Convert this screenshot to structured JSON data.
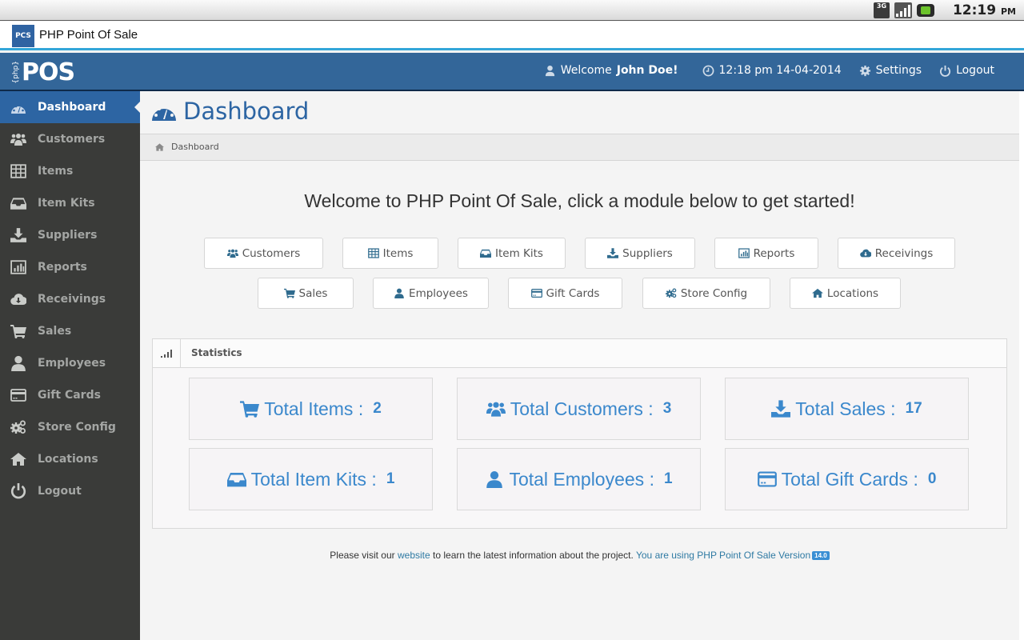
{
  "statusbar": {
    "network": "3G",
    "time": "12:19",
    "ampm": "PM"
  },
  "app": {
    "title": "PHP Point Of Sale",
    "logo_text": "PCS"
  },
  "header": {
    "logo_prefix": "{php}",
    "logo_text": "POS",
    "welcome_prefix": "Welcome",
    "user_name": "John Doe!",
    "datetime": "12:18 pm 14-04-2014",
    "settings_label": "Settings",
    "logout_label": "Logout"
  },
  "sidebar": {
    "items": [
      {
        "label": "Dashboard",
        "icon": "dashboard-icon",
        "active": true
      },
      {
        "label": "Customers",
        "icon": "users-icon"
      },
      {
        "label": "Items",
        "icon": "table-icon"
      },
      {
        "label": "Item Kits",
        "icon": "inbox-icon"
      },
      {
        "label": "Suppliers",
        "icon": "download-icon"
      },
      {
        "label": "Reports",
        "icon": "bar-chart-icon"
      },
      {
        "label": "Receivings",
        "icon": "cloud-download-icon"
      },
      {
        "label": "Sales",
        "icon": "shopping-cart-icon"
      },
      {
        "label": "Employees",
        "icon": "user-icon"
      },
      {
        "label": "Gift Cards",
        "icon": "credit-card-icon"
      },
      {
        "label": "Store Config",
        "icon": "cogs-icon"
      },
      {
        "label": "Locations",
        "icon": "home-icon"
      },
      {
        "label": "Logout",
        "icon": "power-icon"
      }
    ]
  },
  "main": {
    "page_title": "Dashboard",
    "breadcrumb": "Dashboard",
    "welcome": "Welcome to PHP Point Of Sale, click a module below to get started!",
    "modules": [
      {
        "label": "Customers",
        "icon": "users-icon"
      },
      {
        "label": "Items",
        "icon": "table-icon"
      },
      {
        "label": "Item Kits",
        "icon": "inbox-icon"
      },
      {
        "label": "Suppliers",
        "icon": "download-icon"
      },
      {
        "label": "Reports",
        "icon": "bar-chart-icon"
      },
      {
        "label": "Receivings",
        "icon": "cloud-download-icon"
      },
      {
        "label": "Sales",
        "icon": "shopping-cart-icon"
      },
      {
        "label": "Employees",
        "icon": "user-icon"
      },
      {
        "label": "Gift Cards",
        "icon": "credit-card-icon"
      },
      {
        "label": "Store Config",
        "icon": "cogs-icon"
      },
      {
        "label": "Locations",
        "icon": "home-icon"
      }
    ],
    "statistics": {
      "title": "Statistics",
      "boxes": [
        {
          "label": "Total Items :",
          "value": "2",
          "icon": "shopping-cart-icon"
        },
        {
          "label": "Total Customers :",
          "value": "3",
          "icon": "users-icon"
        },
        {
          "label": "Total Sales :",
          "value": "17",
          "icon": "download-icon"
        },
        {
          "label": "Total Item Kits :",
          "value": "1",
          "icon": "inbox-icon"
        },
        {
          "label": "Total Employees :",
          "value": "1",
          "icon": "user-icon"
        },
        {
          "label": "Total Gift Cards :",
          "value": "0",
          "icon": "credit-card-icon"
        }
      ]
    },
    "footer": {
      "text_before": "Please visit our",
      "link_website": "website",
      "text_after": "to learn the latest information about the project.",
      "link_version": "You are using PHP Point Of Sale Version",
      "version_badge": "14.0"
    }
  },
  "colors": {
    "header": "#336699",
    "sidebar": "#3a3b39",
    "active": "#2d65a3",
    "stat_text": "#3b88cc",
    "link": "#2f7aa3"
  }
}
